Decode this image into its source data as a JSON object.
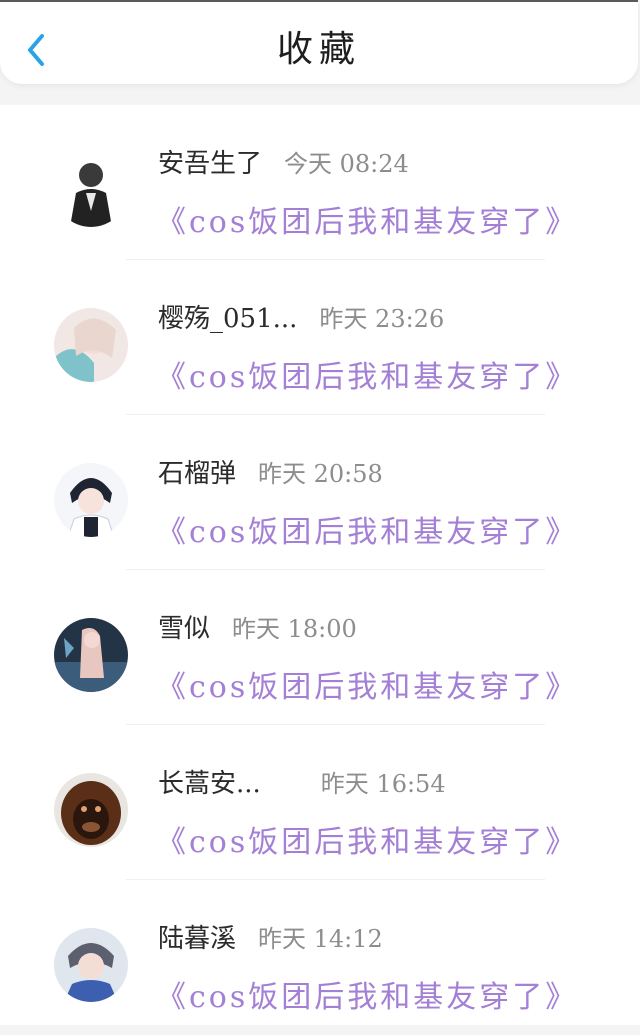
{
  "header": {
    "title": "收藏"
  },
  "items": [
    {
      "name": "安吾生了",
      "time": "今天 08:24",
      "subject": "《cos饭团后我和基友穿了》"
    },
    {
      "name": "樱殇_051...",
      "time": "昨天 23:26",
      "subject": "《cos饭团后我和基友穿了》"
    },
    {
      "name": "石榴弹",
      "time": "昨天 20:58",
      "subject": "《cos饭团后我和基友穿了》"
    },
    {
      "name": "雪似",
      "time": "昨天 18:00",
      "subject": "《cos饭团后我和基友穿了》"
    },
    {
      "name": "长蒿安...",
      "time": "昨天 16:54",
      "subject": "《cos饭团后我和基友穿了》"
    },
    {
      "name": "陆暮溪",
      "time": "昨天 14:12",
      "subject": "《cos饭团后我和基友穿了》"
    }
  ],
  "colors": {
    "accent": "#29a3e6",
    "subject": "#a47fd6",
    "time": "#8d8d8d"
  }
}
